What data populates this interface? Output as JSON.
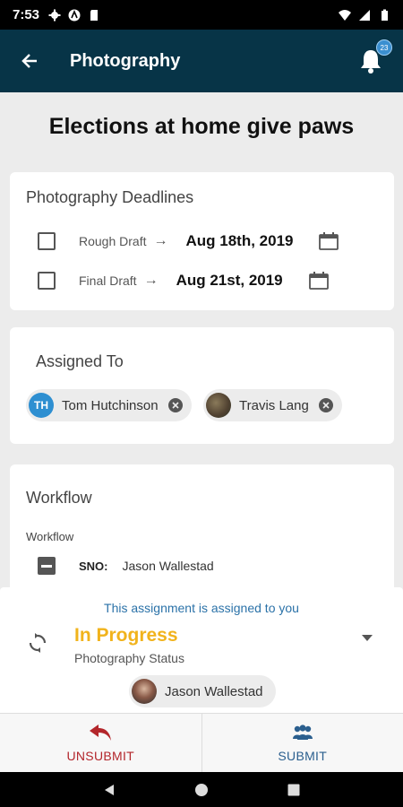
{
  "status_bar": {
    "time": "7:53"
  },
  "app_bar": {
    "title": "Photography",
    "notification_count": "23"
  },
  "page_title": "Elections at home give paws",
  "deadlines": {
    "title": "Photography Deadlines",
    "items": [
      {
        "label": "Rough Draft",
        "date": "Aug 18th, 2019"
      },
      {
        "label": "Final Draft",
        "date": "Aug 21st, 2019"
      }
    ]
  },
  "assigned": {
    "title": "Assigned To",
    "people": [
      {
        "name": "Tom Hutchinson",
        "initials": "TH"
      },
      {
        "name": "Travis Lang"
      }
    ]
  },
  "workflow": {
    "title": "Workflow",
    "sub_label": "Workflow",
    "rows": [
      {
        "role": "SNO:",
        "person": "Jason Wallestad"
      }
    ]
  },
  "bottom": {
    "note": "This assignment is assigned to you",
    "status_value": "In Progress",
    "status_label": "Photography Status",
    "owner": "Jason Wallestad"
  },
  "actions": {
    "unsubmit": "UNSUBMIT",
    "submit": "SUBMIT"
  },
  "colors": {
    "app_bar": "#073447",
    "status_value": "#f1b31c",
    "unsubmit": "#b3262b",
    "submit": "#2b5f8e"
  }
}
